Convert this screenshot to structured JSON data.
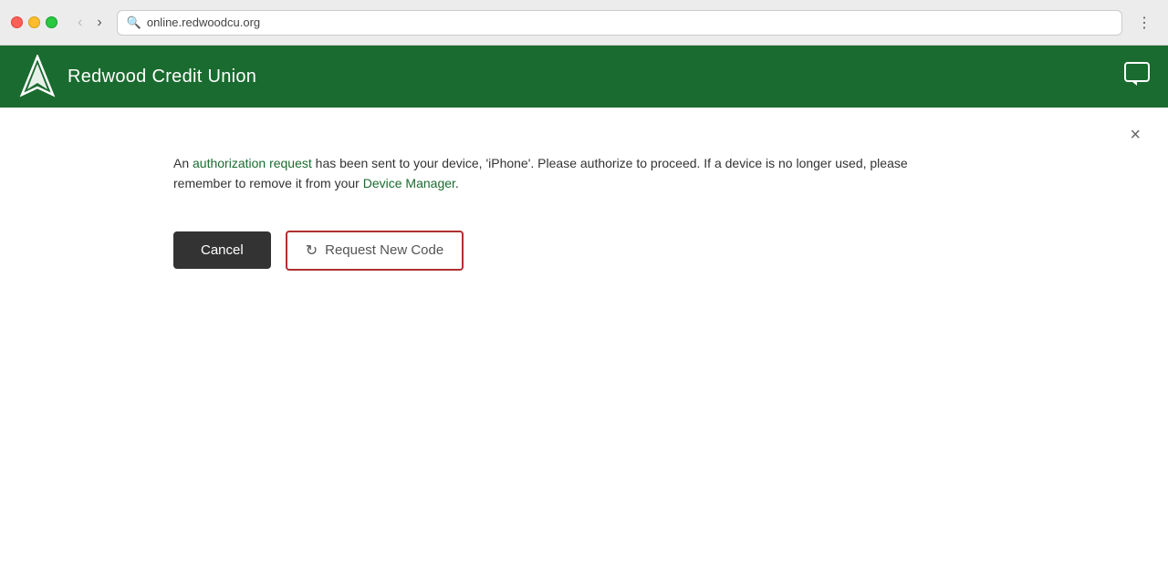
{
  "browser": {
    "tab_label": "Redwood Credit Union",
    "address": "online.redwoodcu.org"
  },
  "header": {
    "site_title": "Redwood Credit Union",
    "logo_alt": "Redwood Credit Union Logo"
  },
  "dialog": {
    "message_part1": "An ",
    "message_link1": "authorization request",
    "message_part2": " has been sent to your device, 'iPhone'. Please authorize to proceed. If a device is no longer used, please remember to remove it from your ",
    "message_link2": "Device Manager",
    "message_part3": ".",
    "cancel_label": "Cancel",
    "request_code_label": "Request New Code",
    "close_label": "×"
  },
  "icons": {
    "chat": "💬",
    "refresh": "↺",
    "close": "×",
    "search": "🔍"
  }
}
